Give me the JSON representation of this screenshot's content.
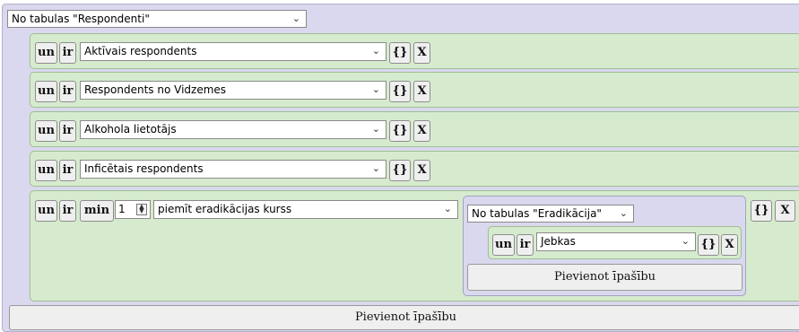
{
  "colors": {
    "outer_bg": "#d9d8ee",
    "row_bg": "#d6ebce",
    "button_bg": "#efefef"
  },
  "main": {
    "table_select": "No tabulas \"Respondenti\"",
    "buttons": {
      "un": "un",
      "ir": "ir",
      "min": "min",
      "braces": "{}",
      "remove": "X"
    },
    "rows": [
      {
        "property": "Aktīvais respondents"
      },
      {
        "property": "Respondents no Vidzemes"
      },
      {
        "property": "Alkohola lietotājs"
      },
      {
        "property": "Inficētais respondents"
      }
    ],
    "complex_row": {
      "min_value": "1",
      "property": "piemīt eradikācijas kurss",
      "sub": {
        "table_select": "No tabulas \"Eradikācija\"",
        "row_property": "Jebkas",
        "add_label": "Pievienot īpašību"
      }
    },
    "add_label": "Pievienot īpašību"
  }
}
